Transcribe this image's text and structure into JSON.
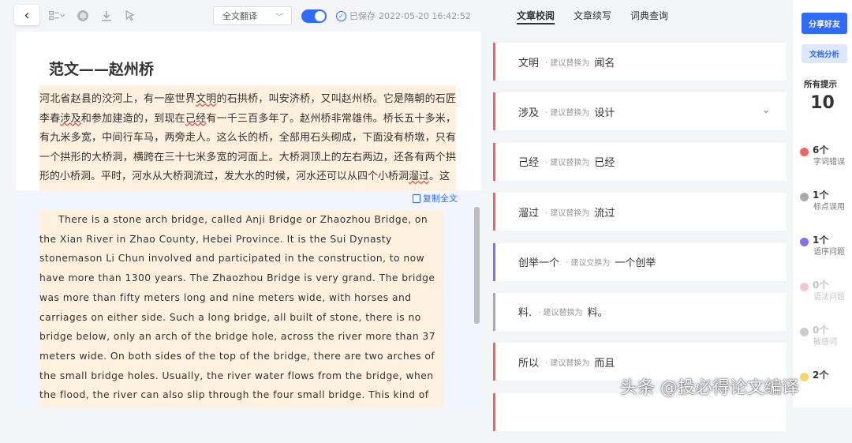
{
  "toolbar": {
    "back_icon": "‹",
    "select_value": "全文翻译",
    "saved_label": "已保存",
    "saved_time": "2022-05-20 16:42:52"
  },
  "document": {
    "title": "范文——赵州桥",
    "cn_segments": [
      {
        "text": "河北省赵县的洨河上，有一座世界",
        "u": false
      },
      {
        "text": "文明",
        "u": true
      },
      {
        "text": "的石拱桥，叫安济桥，又叫赵州桥。它是隋朝的石匠李春",
        "u": false
      },
      {
        "text": "涉及",
        "u": true
      },
      {
        "text": "和参加建造的，到现在",
        "u": false
      },
      {
        "text": "己经",
        "u": true
      },
      {
        "text": "有一千三百多年了。赵州桥非常雄伟。桥长五十多米，有九米多宽，中间行车马，两旁走人。这么长的桥，全部用石头砌成，下面没有桥墩，只有一个拱形的大桥洞，横跨在三十七米多宽的河面上。大桥洞顶上的左右两边，还各有两个拱形的小桥洞。平时，河水从大桥洞流过，发大水的时候，河水还可以从四个小桥洞",
        "u": false
      },
      {
        "text": "溜过",
        "u": true
      },
      {
        "text": "。这",
        "u": false
      }
    ],
    "copy_label": "复制全文",
    "en_text": "There is a stone arch bridge, called Anji Bridge or Zhaozhou Bridge, on the Xian River in Zhao County, Hebei Province. It is the Sui Dynasty stonemason Li Chun involved and participated in the construction, to now have more than 1300 years. The Zhaozhou Bridge is very grand. The bridge was more than fifty meters long and nine meters wide, with horses and carriages on either side. Such a long bridge, all built of stone, there is no bridge below, only an arch of the bridge hole, across the river more than 37 meters wide. On both sides of the top of the bridge, there are two arches of the small bridge holes. Usually, the river water flows from the bridge, when the flood, the river can also slip through the four small bridge. This kind of design is an innovation in the history"
  },
  "tabs": [
    "文章校阅",
    "文章续写",
    "词典查询"
  ],
  "suggestions": [
    {
      "orig": "文明",
      "hint": "· 建议替换为",
      "sug": "闻名",
      "color": "#f06464",
      "chevron": false
    },
    {
      "orig": "涉及",
      "hint": "· 建议替换为",
      "sug": "设计",
      "color": "#f06464",
      "chevron": true
    },
    {
      "orig": "己经",
      "hint": "· 建议替换为",
      "sug": "已经",
      "color": "#f06464",
      "chevron": false
    },
    {
      "orig": "溜过",
      "hint": "· 建议替换为",
      "sug": "流过",
      "color": "#f06464",
      "chevron": false
    },
    {
      "orig": "创举一个",
      "hint": "· 建议交换为",
      "sug": "一个创举",
      "color": "#8a6cf0",
      "chevron": false
    },
    {
      "orig": "料.",
      "hint": "· 建议替换为",
      "sug": "料。",
      "color": "#aaaaaa",
      "chevron": false
    },
    {
      "orig": "所以",
      "hint": "· 建议替换为",
      "sug": "而且",
      "color": "#f06464",
      "chevron": false
    },
    {
      "orig": "",
      "hint": "",
      "sug": "",
      "color": "#f06464",
      "chevron": false
    }
  ],
  "sidebar": {
    "share_label": "分享好友",
    "analysis_label": "文档分析",
    "all_label": "所有提示",
    "all_count": "10",
    "stats": [
      {
        "num": "6个",
        "label": "字词错误",
        "color": "#f06464",
        "dim": false
      },
      {
        "num": "1个",
        "label": "标点误用",
        "color": "#aaaaaa",
        "dim": false
      },
      {
        "num": "1个",
        "label": "语序问题",
        "color": "#8a6cf0",
        "dim": false
      },
      {
        "num": "0个",
        "label": "语法问题",
        "color": "#f5c6d4",
        "dim": true
      },
      {
        "num": "0个",
        "label": "敏感词",
        "color": "#cccccc",
        "dim": true
      },
      {
        "num": "2个",
        "label": "",
        "color": "#f5d66a",
        "dim": false
      }
    ]
  },
  "watermark": "头条 @投必得论文编译"
}
